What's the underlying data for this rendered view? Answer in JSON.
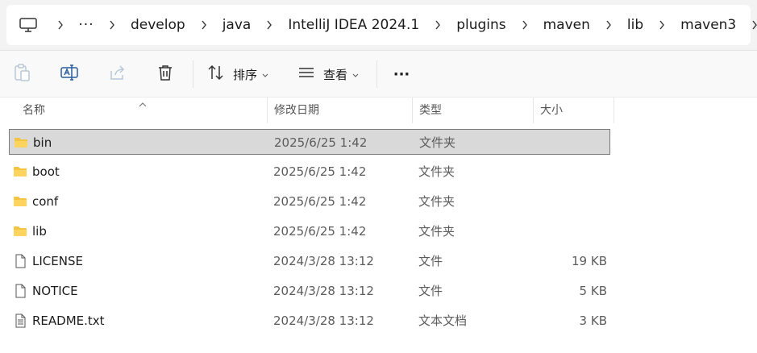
{
  "address_bar": {
    "icon": "computer-icon",
    "overflow_label": "···",
    "crumbs": [
      "develop",
      "java",
      "IntelliJ IDEA 2024.1",
      "plugins",
      "maven",
      "lib",
      "maven3"
    ]
  },
  "toolbar": {
    "sort_label": "排序",
    "view_label": "查看",
    "more_label": "···"
  },
  "columns": {
    "name": "名称",
    "date": "修改日期",
    "type": "类型",
    "size": "大小"
  },
  "files": [
    {
      "name": "bin",
      "date": "2025/6/25 1:42",
      "type": "文件夹",
      "size": "",
      "kind": "folder",
      "selected": true
    },
    {
      "name": "boot",
      "date": "2025/6/25 1:42",
      "type": "文件夹",
      "size": "",
      "kind": "folder",
      "selected": false
    },
    {
      "name": "conf",
      "date": "2025/6/25 1:42",
      "type": "文件夹",
      "size": "",
      "kind": "folder",
      "selected": false
    },
    {
      "name": "lib",
      "date": "2025/6/25 1:42",
      "type": "文件夹",
      "size": "",
      "kind": "folder",
      "selected": false
    },
    {
      "name": "LICENSE",
      "date": "2024/3/28 13:12",
      "type": "文件",
      "size": "19 KB",
      "kind": "file",
      "selected": false
    },
    {
      "name": "NOTICE",
      "date": "2024/3/28 13:12",
      "type": "文件",
      "size": "5 KB",
      "kind": "file",
      "selected": false
    },
    {
      "name": "README.txt",
      "date": "2024/3/28 13:12",
      "type": "文本文档",
      "size": "3 KB",
      "kind": "text-file",
      "selected": false
    }
  ],
  "colors": {
    "folder": "#f4c542",
    "selection": "#d9d9d9",
    "accent": "#0067c0"
  }
}
